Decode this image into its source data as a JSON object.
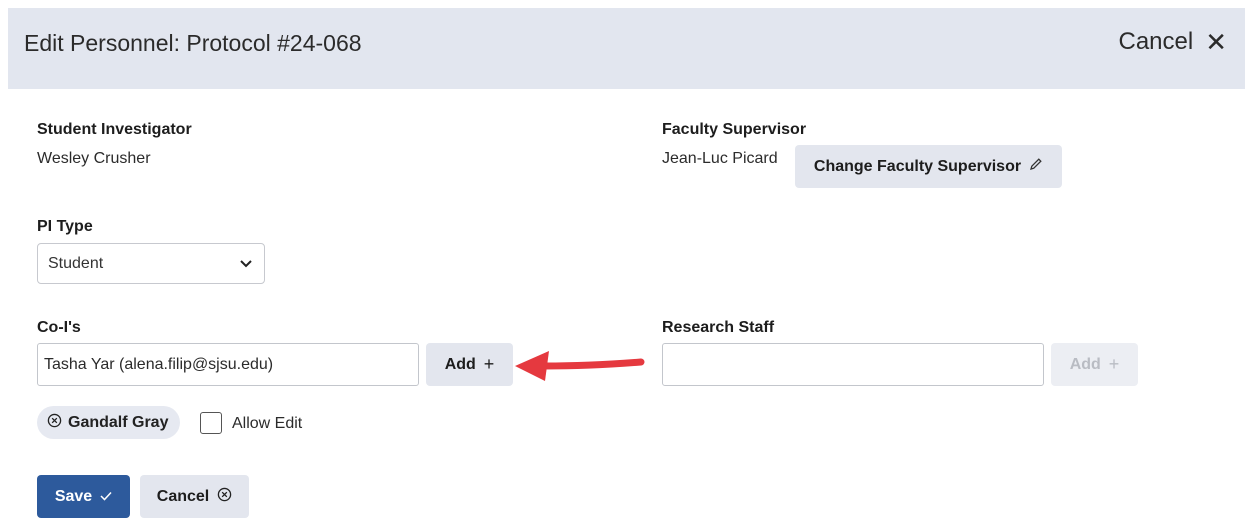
{
  "header": {
    "title": "Edit Personnel: Protocol #24-068",
    "cancel_label": "Cancel"
  },
  "student": {
    "label": "Student Investigator",
    "name": "Wesley Crusher"
  },
  "faculty": {
    "label": "Faculty Supervisor",
    "name": "Jean-Luc Picard",
    "change_button": "Change Faculty Supervisor"
  },
  "pi_type": {
    "label": "PI Type",
    "selected": "Student"
  },
  "coi": {
    "label": "Co-I's",
    "input_value": "Tasha Yar (alena.filip@sjsu.edu)",
    "add_button": "Add"
  },
  "research_staff": {
    "label": "Research Staff",
    "input_value": "",
    "add_button": "Add"
  },
  "chip": {
    "name": "Gandalf Gray",
    "allow_edit_label": "Allow Edit",
    "allow_edit_checked": false
  },
  "actions": {
    "save_label": "Save",
    "cancel_label": "Cancel"
  },
  "icons": {
    "close": "close-icon",
    "pencil": "pencil-icon",
    "chevron": "chevron-down-icon",
    "plus": "plus-icon",
    "remove": "circle-x-icon",
    "check": "check-icon"
  },
  "colors": {
    "header_bg": "#e2e6ef",
    "primary": "#2d5a9c",
    "annotation_arrow": "#e5393f"
  }
}
